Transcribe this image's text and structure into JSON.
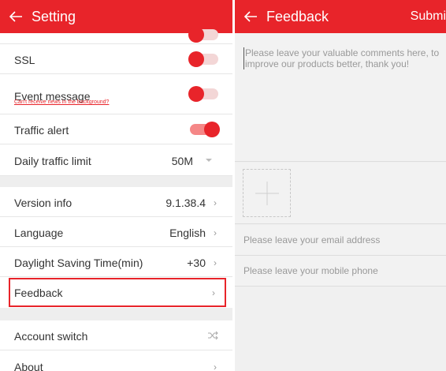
{
  "left": {
    "header": {
      "title": "Setting"
    },
    "rows": [
      {
        "label": "SSL"
      },
      {
        "label": "Event message",
        "sublink": "Can't receive news in the background?"
      },
      {
        "label": "Traffic alert"
      },
      {
        "label": "Daily traffic limit",
        "value": "50M"
      },
      {
        "label": "Version info",
        "value": "9.1.38.4"
      },
      {
        "label": "Language",
        "value": "English"
      },
      {
        "label": "Daylight Saving Time(min)",
        "value": "+30"
      },
      {
        "label": "Feedback"
      },
      {
        "label": "Account switch"
      },
      {
        "label": "About"
      }
    ]
  },
  "right": {
    "header": {
      "title": "Feedback",
      "submit": "Submi"
    },
    "comment_placeholder": "Please leave your valuable comments here, to improve our products better, thank you!",
    "email_placeholder": "Please leave your email address",
    "phone_placeholder": "Please leave your mobile phone"
  },
  "colors": {
    "accent": "#e8242a",
    "highlight_border": "#e8242a"
  },
  "icons": [
    "back-arrow-icon",
    "toggle-switch",
    "chevron-right-icon",
    "dropdown-caret-icon",
    "shuffle-icon",
    "plus-icon"
  ]
}
